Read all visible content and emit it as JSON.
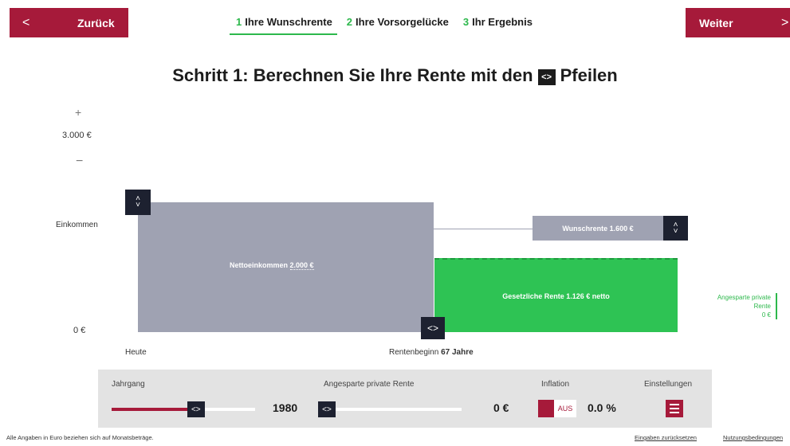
{
  "nav": {
    "back_icon": "chevron-left-icon",
    "back_glyph": "<",
    "back_label": "Zurück",
    "next_label": "Weiter",
    "next_icon": "chevron-right-icon",
    "next_glyph": ">",
    "steps": [
      {
        "num": "1",
        "label": "Ihre Wunschrente",
        "active": true
      },
      {
        "num": "2",
        "label": "Ihre Vorsorgelücke",
        "active": false
      },
      {
        "num": "3",
        "label": "Ihr Ergebnis",
        "active": false
      }
    ],
    "accent_color": "#a61a3a",
    "step_color": "#2db84c"
  },
  "headline": {
    "before": "Schritt 1: Berechnen Sie Ihre Rente mit den",
    "icon_glyph": "<>",
    "after": "Pfeilen"
  },
  "scale": {
    "plus_glyph": "+",
    "value": "3.000 €",
    "minus_glyph": "−",
    "axis_label": "Einkommen",
    "zero": "0 €"
  },
  "chart": {
    "income_label": "Nettoeinkommen",
    "income_value": "2.000 €",
    "income_handle_up": "˄",
    "income_handle_down": "˅",
    "wish_label": "Wunschrente 1.600 €",
    "wish_handle_up": "˄",
    "wish_handle_down": "˅",
    "pension_label": "Gesetzliche Rente 1.126 € netto",
    "rent_handle_glyph": "<>",
    "private_line1": "Angesparte private",
    "private_line2": "Rente",
    "private_value": "0 €",
    "heute": "Heute",
    "start_label": "Rentenbeginn",
    "start_age": "67 Jahre",
    "income_color": "#9fa2b2",
    "pension_color": "#2ec354"
  },
  "panel": {
    "jahrgang_title": "Jahrgang",
    "jahrgang_value": "1980",
    "jahrgang_fill_percent": 56,
    "slider_glyph": "<>",
    "private_title": "Angesparte private Rente",
    "private_value": "0 €",
    "private_fill_percent": 0,
    "inflation_title": "Inflation",
    "inflation_toggle": "AUS",
    "inflation_value": "0.0 %",
    "settings_title": "Einstellungen",
    "settings_icon": "sliders-icon"
  },
  "footer": {
    "note": "Alle Angaben in Euro beziehen sich auf Monatsbeträge.",
    "reset_link": "Eingaben zurücksetzen",
    "terms_link": "Nutzungsbedingungen"
  }
}
